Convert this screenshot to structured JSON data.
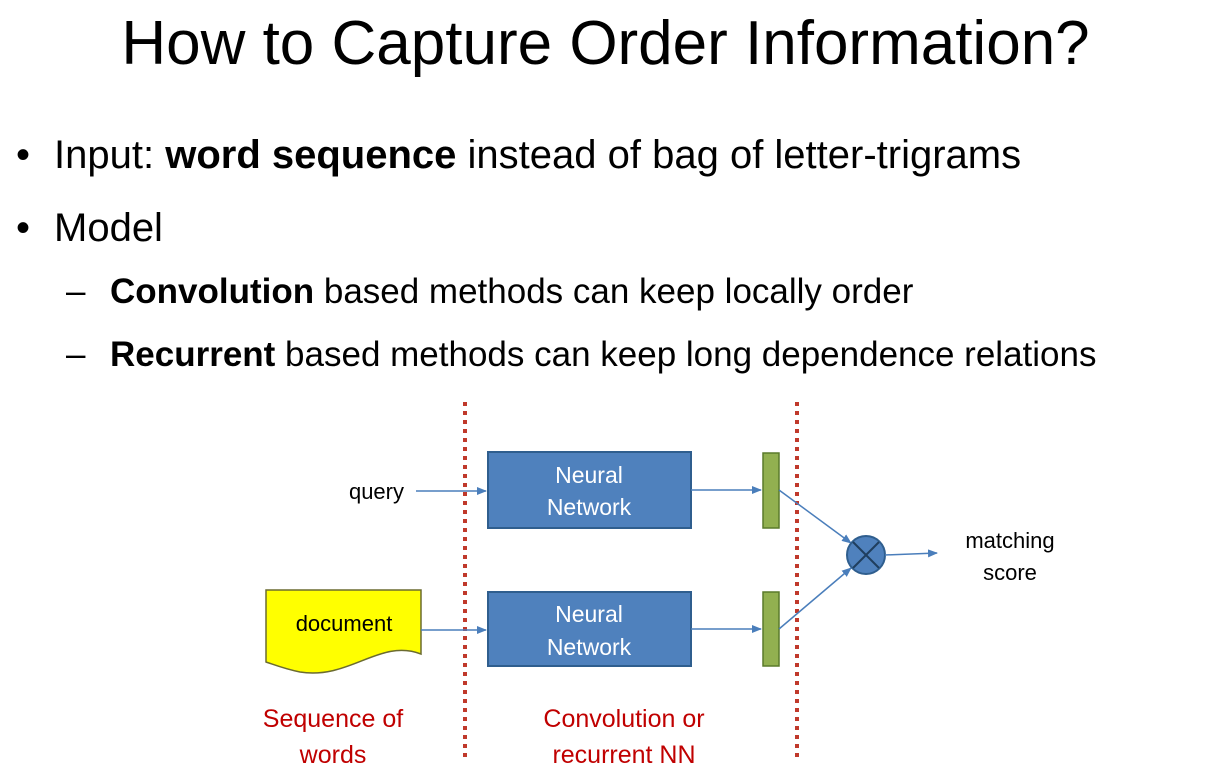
{
  "title": "How to Capture Order Information?",
  "bullets": [
    {
      "marker": "•",
      "prefix": "Input: ",
      "bold": "word sequence",
      "suffix": " instead of bag of letter-trigrams"
    },
    {
      "marker": "•",
      "text": "Model"
    }
  ],
  "sub_bullets": [
    {
      "marker": "–",
      "bold": "Convolution",
      "suffix": " based methods can keep locally order"
    },
    {
      "marker": "–",
      "bold": "Recurrent",
      "suffix": " based methods can keep long dependence relations"
    }
  ],
  "diagram": {
    "query_label": "query",
    "document_label": "document",
    "nn_top_line1": "Neural",
    "nn_top_line2": "Network",
    "nn_bottom_line1": "Neural",
    "nn_bottom_line2": "Network",
    "output_line1": "matching",
    "output_line2": "score",
    "caption_left_line1": "Sequence of",
    "caption_left_line2": "words",
    "caption_mid_line1": "Convolution or",
    "caption_mid_line2": "recurrent NN",
    "colors": {
      "nn_fill": "#4f81bd",
      "nn_stroke": "#2f5e8e",
      "vector_fill": "#92b050",
      "document_fill": "#ffff00",
      "divider": "#c0392b",
      "caption": "#c00000",
      "arrow": "#4a7ebb"
    }
  }
}
